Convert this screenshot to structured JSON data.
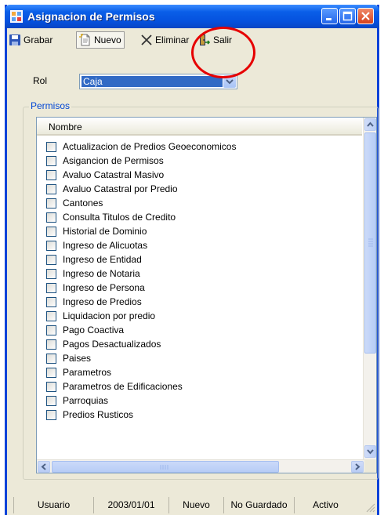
{
  "window": {
    "title": "Asignacion de Permisos"
  },
  "toolbar": {
    "grabar": "Grabar",
    "nuevo": "Nuevo",
    "eliminar": "Eliminar",
    "salir": "Salir"
  },
  "rol": {
    "label": "Rol",
    "value": "Caja"
  },
  "permisos": {
    "group_label": "Permisos",
    "column_header": "Nombre",
    "items": [
      "Actualizacion de Predios Geoeconomicos",
      "Asigancion de Permisos",
      "Avaluo Catastral Masivo",
      "Avaluo Catastral por Predio",
      "Cantones",
      "Consulta Titulos de Credito",
      "Historial de Dominio",
      "Ingreso de Alicuotas",
      "Ingreso de Entidad",
      "Ingreso de Notaria",
      "Ingreso de Persona",
      "Ingreso de Predios",
      "Liquidacion por predio",
      "Pago Coactiva",
      "Pagos Desactualizados",
      "Paises",
      "Parametros",
      "Parametros de Edificaciones",
      "Parroquias",
      "Predios Rusticos"
    ]
  },
  "statusbar": {
    "usuario": "Usuario",
    "fecha": "2003/01/01",
    "modo": "Nuevo",
    "guardado": "No Guardado",
    "estado": "Activo"
  },
  "colors": {
    "titlebar": "#0a5fe8",
    "selection": "#316ac5",
    "group_label": "#0046d5",
    "annotation": "#e60000"
  }
}
